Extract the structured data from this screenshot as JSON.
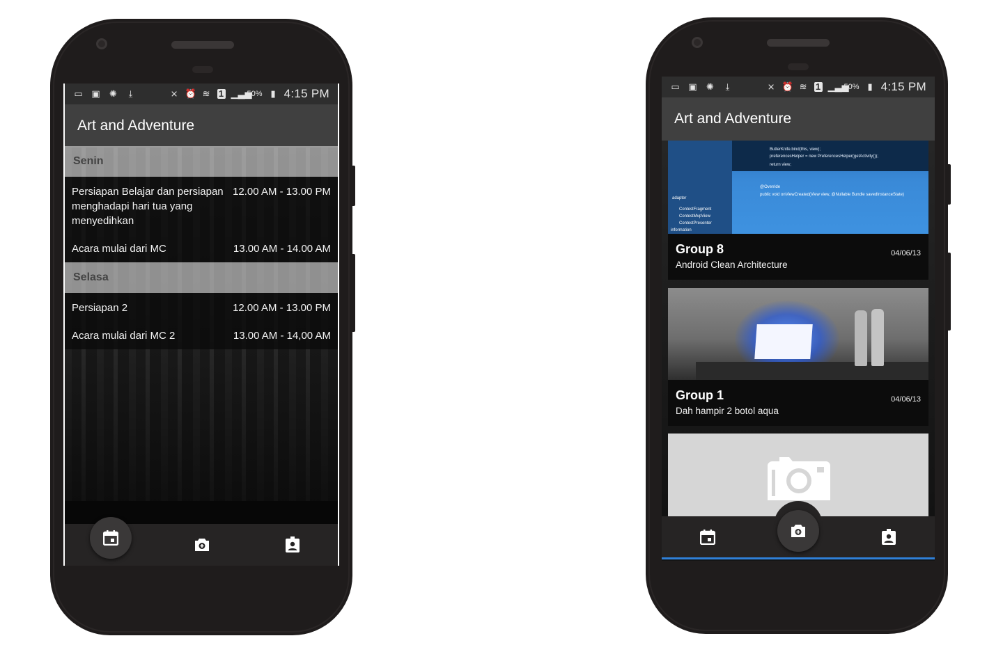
{
  "app_title": "Art and Adventure",
  "status_bar": {
    "icons": [
      "message-icon",
      "image-icon",
      "android-icon",
      "download-icon",
      "mute-icon",
      "alarm-icon",
      "wifi-icon",
      "sim-icon",
      "signal-icon"
    ],
    "sim_label": "1",
    "battery": "50%",
    "time": "4:15 PM"
  },
  "schedule": {
    "days": [
      {
        "name": "Senin",
        "events": [
          {
            "title": "Persiapan Belajar dan persiapan menghadapi hari tua yang menyedihkan",
            "time": "12.00 AM - 13.00 PM"
          },
          {
            "title": "Acara mulai dari MC",
            "time": "13.00 AM - 14.00 AM"
          }
        ]
      },
      {
        "name": "Selasa",
        "events": [
          {
            "title": "Persiapan 2",
            "time": "12.00 AM - 13.00 PM"
          },
          {
            "title": "Acara mulai dari MC 2",
            "time": "13.00 AM - 14,00 AM"
          }
        ]
      }
    ]
  },
  "groups": [
    {
      "name": "Group 8",
      "subtitle": "Android Clean Architecture",
      "date": "04/06/13"
    },
    {
      "name": "Group 1",
      "subtitle": "Dah hampir 2 botol aqua",
      "date": "04/06/13"
    }
  ],
  "code_snippet": [
    "ButterKnife.bind(this, view);",
    "preferencesHelper = new PreferencesHelper(getActivity());",
    "return view;",
    "@Override",
    "public void onViewCreated(View view, @Nullable Bundle savedInstanceState)",
    "ContestFragment",
    "ContestMvpView",
    "ContestPresenter",
    "adapter",
    "information"
  ],
  "nav": {
    "left_screen_active": "schedule",
    "right_screen_active": "gallery"
  },
  "colors": {
    "app_bar": "#404040",
    "day_header": "#bebebe",
    "accent": "#2f80d8",
    "nav_bg": "#262424"
  }
}
